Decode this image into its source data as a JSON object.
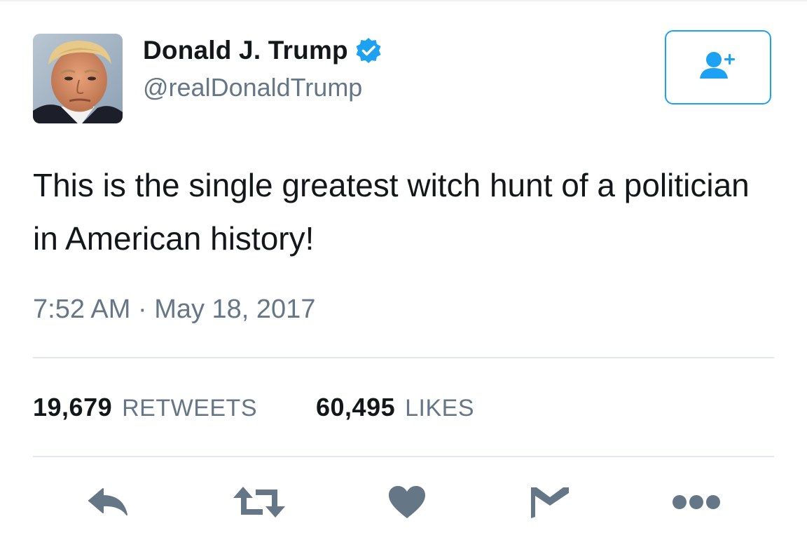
{
  "tweet": {
    "author": {
      "display_name": "Donald J. Trump",
      "handle": "@realDonaldTrump",
      "verified_icon": "verified-badge-icon",
      "avatar_icon": "profile-photo"
    },
    "follow_button_icon": "add-user-icon",
    "text": "This is the single greatest witch hunt of a politician in American history!",
    "timestamp": "7:52 AM · May 18, 2017",
    "stats": {
      "retweets_count": "19,679",
      "retweets_label": "RETWEETS",
      "likes_count": "60,495",
      "likes_label": "LIKES"
    },
    "actions": [
      {
        "name": "reply",
        "icon": "reply-icon"
      },
      {
        "name": "retweet",
        "icon": "retweet-icon"
      },
      {
        "name": "like",
        "icon": "heart-icon"
      },
      {
        "name": "direct-message",
        "icon": "envelope-icon"
      },
      {
        "name": "more",
        "icon": "more-dots-icon"
      }
    ]
  },
  "colors": {
    "brand_blue": "#1da1f2",
    "text_primary": "#14171a",
    "text_secondary": "#657786",
    "divider": "#e1e8ed",
    "icon_gray": "#657786"
  }
}
